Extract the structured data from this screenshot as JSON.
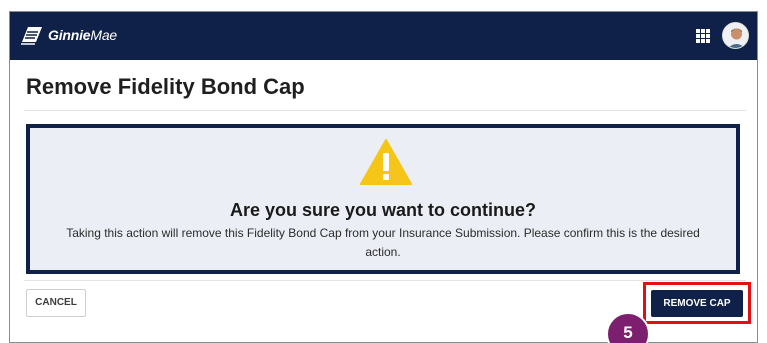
{
  "header": {
    "logo_text_bold": "Ginnie",
    "logo_text_light": "Mae",
    "apps_icon": "grid-icon",
    "avatar_icon": "user-avatar"
  },
  "page": {
    "title": "Remove Fidelity Bond Cap"
  },
  "alert": {
    "icon": "warning-triangle-icon",
    "icon_color": "#f5c518",
    "heading": "Are you sure you want to continue?",
    "message": "Taking this action will remove this Fidelity Bond Cap from your Insurance Submission. Please confirm this is the desired action."
  },
  "footer": {
    "cancel_label": "CANCEL",
    "remove_label": "REMOVE CAP"
  },
  "annotation": {
    "step_number": "5",
    "highlight_color": "#e01014",
    "badge_color": "#7b1f6e"
  },
  "colors": {
    "navy": "#0f2049",
    "alert_bg": "#ebeff5"
  }
}
